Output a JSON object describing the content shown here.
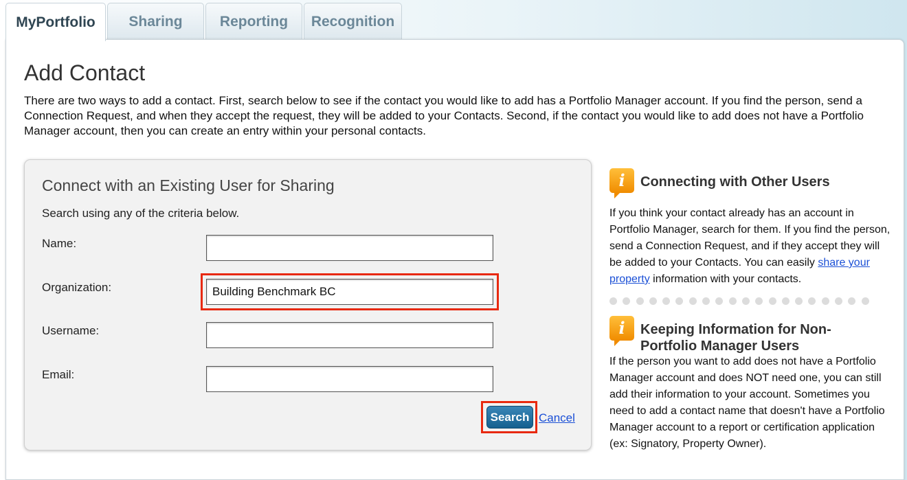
{
  "tabs": [
    {
      "label": "MyPortfolio",
      "active": true
    },
    {
      "label": "Sharing",
      "active": false
    },
    {
      "label": "Reporting",
      "active": false
    },
    {
      "label": "Recognition",
      "active": false
    }
  ],
  "page": {
    "title": "Add Contact",
    "intro": "There are two ways to add a contact. First, search below to see if the contact you would like to add has a Portfolio Manager account. If you find the person, send a Connection Request, and when they accept the request, they will be added to your Contacts. Second, if the contact you would like to add does not have a Portfolio Manager account, then you can create an entry within your personal contacts."
  },
  "search_box": {
    "title": "Connect with an Existing User for Sharing",
    "subtitle": "Search using any of the criteria below.",
    "fields": {
      "name": {
        "label": "Name:",
        "value": ""
      },
      "organization": {
        "label": "Organization:",
        "value": "Building Benchmark BC"
      },
      "username": {
        "label": "Username:",
        "value": ""
      },
      "email": {
        "label": "Email:",
        "value": ""
      }
    },
    "search_label": "Search",
    "cancel_label": "Cancel",
    "highlight_color": "#e8290f"
  },
  "sidebar": {
    "connecting": {
      "heading": "Connecting with Other Users",
      "text_before": "If you think your contact already has an account in Portfolio Manager, search for them. If you find the person, send a Connection Request, and if they accept they will be added to your Contacts. You can easily",
      "link": "share your property",
      "text_after": "information with your contacts."
    },
    "keeping": {
      "heading": "Keeping Information for Non-Portfolio Manager Users",
      "text": "If the person you want to add does not have a Portfolio Manager account and does NOT need one, you can still add their information to your account. Sometimes you need to add a contact name that doesn't have a Portfolio Manager account to a report or certification application (ex: Signatory, Property Owner)."
    },
    "icon": "info-icon",
    "divider_dot_count": 20
  },
  "colors": {
    "accent_button": "#15608f",
    "link": "#1a4fd6",
    "info_icon": "#f08c00"
  }
}
